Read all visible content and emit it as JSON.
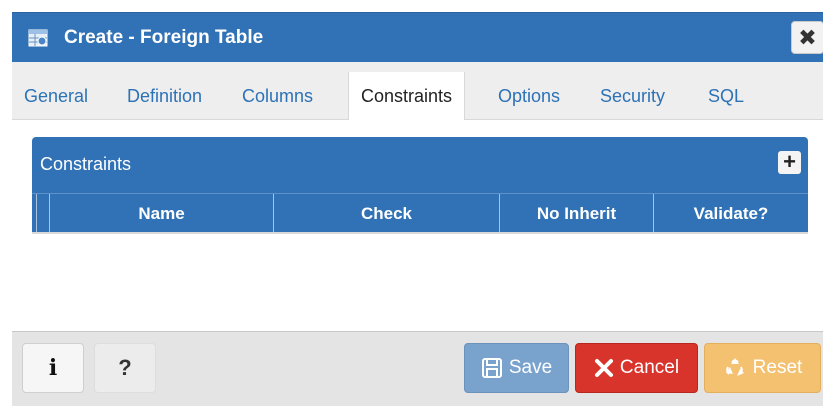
{
  "window": {
    "title": "Create - Foreign Table",
    "close_glyph": "✖",
    "title_icon": "foreign-table-icon"
  },
  "tabs": [
    {
      "label": "General",
      "active": false
    },
    {
      "label": "Definition",
      "active": false
    },
    {
      "label": "Columns",
      "active": false
    },
    {
      "label": "Constraints",
      "active": true
    },
    {
      "label": "Options",
      "active": false
    },
    {
      "label": "Security",
      "active": false
    },
    {
      "label": "SQL",
      "active": false
    }
  ],
  "constraints": {
    "title": "Constraints",
    "add_glyph": "+",
    "columns": [
      "Name",
      "Check",
      "No Inherit",
      "Validate?"
    ],
    "rows": []
  },
  "footer": {
    "info_glyph": "i",
    "help_glyph": "?",
    "save_label": "Save",
    "cancel_label": "Cancel",
    "reset_label": "Reset"
  },
  "colors": {
    "header_blue": "#3072b5",
    "save": "#79a2cd",
    "cancel": "#d9342c",
    "reset": "#f3c170"
  }
}
